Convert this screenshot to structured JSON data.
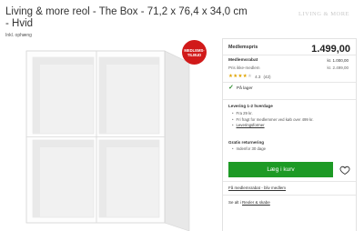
{
  "header": {
    "title": "Living & more reol - The Box - 71,2 x 76,4 x 34,0 cm - Hvid",
    "subtitle": "Inkl. ophæng",
    "brand": "LIVING & MORE"
  },
  "badge": {
    "line1": "MEDLEMS-",
    "line2": "TILBUD"
  },
  "pricing": {
    "member_price_label": "Medlemspris",
    "member_price": "1.499,00",
    "member_discount_label": "Medlemsrabat",
    "member_discount_value": "kr. 1.000,00",
    "non_member_label": "Pris ikke-medlem",
    "non_member_value": "kr. 2.499,00"
  },
  "rating": {
    "score": "4.3",
    "count": "(42)",
    "stars_filled": 4,
    "stars_total": 5
  },
  "stock": {
    "label": "På lager"
  },
  "delivery": {
    "title": "Levering 1-2 hverdage",
    "items": [
      "Fra 29 kr.",
      "Fri fragt for medlemmer ved køb over 499 kr."
    ],
    "link": "Leveringsformer"
  },
  "returns": {
    "title": "Gratis returnering",
    "items": [
      "Indenfor 30 dage"
    ]
  },
  "actions": {
    "add_to_cart": "Læg i kurv",
    "member_link": "Få medlemsrabat - bliv medlem",
    "see_all_prefix": "Se alt i",
    "see_all_link": "Reoler & skabe"
  },
  "colors": {
    "accent_green": "#1d9a25",
    "badge_red": "#d11a1a",
    "star_gold": "#e0a400"
  }
}
